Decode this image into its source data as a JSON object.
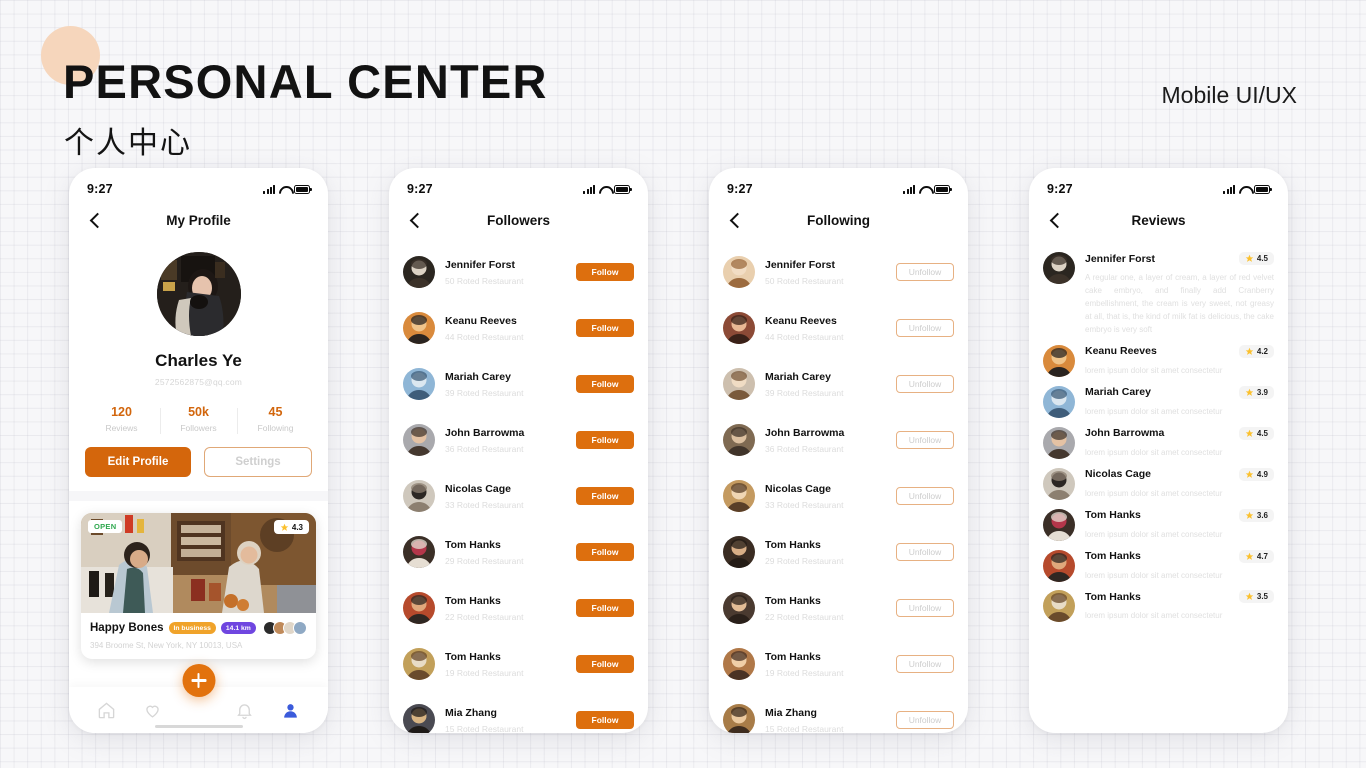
{
  "header": {
    "title": "PERSONAL CENTER",
    "subtitle": "个人中心",
    "tag": "Mobile UI/UX",
    "accent": "#d4660c",
    "circle_color": "#f6d6bc"
  },
  "status_bar": {
    "time": "9:27",
    "icons": [
      "signal-icon",
      "wifi-icon",
      "battery-icon"
    ]
  },
  "screen_profile": {
    "nav_title": "My Profile",
    "back_icon": "chevron-left-icon",
    "name": "Charles Ye",
    "email": "2572562875@qq.com",
    "stats": [
      {
        "value": "120",
        "label": "Reviews"
      },
      {
        "value": "50k",
        "label": "Followers"
      },
      {
        "value": "45",
        "label": "Following"
      }
    ],
    "edit_label": "Edit Profile",
    "settings_label": "Settings",
    "restaurant": {
      "open_badge": "OPEN",
      "rating": "4.3",
      "name": "Happy Bones",
      "chip_business": "In business",
      "chip_distance": "14.1 km",
      "address": "394 Broome St, New York, NY 10013, USA"
    },
    "tabs": [
      "home-icon",
      "heart-icon",
      "add-icon",
      "bell-icon",
      "profile-icon"
    ]
  },
  "screen_followers": {
    "nav_title": "Followers",
    "action_label": "Follow",
    "rows": [
      {
        "name": "Jennifer Forst",
        "sub": "50 Roted Restaurant"
      },
      {
        "name": "Keanu Reeves",
        "sub": "44 Roted Restaurant"
      },
      {
        "name": "Mariah Carey",
        "sub": "39 Roted Restaurant"
      },
      {
        "name": "John Barrowma",
        "sub": "36 Roted Restaurant"
      },
      {
        "name": "Nicolas Cage",
        "sub": "33 Roted Restaurant"
      },
      {
        "name": "Tom Hanks",
        "sub": "29 Roted Restaurant"
      },
      {
        "name": "Tom Hanks",
        "sub": "22 Roted Restaurant"
      },
      {
        "name": "Tom Hanks",
        "sub": "19 Roted Restaurant"
      },
      {
        "name": "Mia Zhang",
        "sub": "15 Roted Restaurant"
      }
    ]
  },
  "screen_following": {
    "nav_title": "Following",
    "action_label": "Unfollow",
    "rows": [
      {
        "name": "Jennifer Forst",
        "sub": "50 Roted Restaurant"
      },
      {
        "name": "Keanu Reeves",
        "sub": "44 Roted Restaurant"
      },
      {
        "name": "Mariah Carey",
        "sub": "39 Roted Restaurant"
      },
      {
        "name": "John Barrowma",
        "sub": "36 Roted Restaurant"
      },
      {
        "name": "Nicolas Cage",
        "sub": "33 Roted Restaurant"
      },
      {
        "name": "Tom Hanks",
        "sub": "29 Roted Restaurant"
      },
      {
        "name": "Tom Hanks",
        "sub": "22 Roted Restaurant"
      },
      {
        "name": "Tom Hanks",
        "sub": "19 Roted Restaurant"
      },
      {
        "name": "Mia Zhang",
        "sub": "15 Roted Restaurant"
      }
    ]
  },
  "screen_reviews": {
    "nav_title": "Reviews",
    "rows": [
      {
        "name": "Jennifer Forst",
        "rating": "4.5",
        "text": "A regular one, a layer of cream, a layer of red velvet cake embryo, and finally add Cranberry embellishment, the cream is very sweet, not greasy at all, that is, the kind of milk fat is delicious, the cake embryo is very soft"
      },
      {
        "name": "Keanu Reeves",
        "rating": "4.2",
        "text": "lorem ipsum dolor sit amet consectetur"
      },
      {
        "name": "Mariah Carey",
        "rating": "3.9",
        "text": "lorem ipsum dolor sit amet consectetur"
      },
      {
        "name": "John Barrowma",
        "rating": "4.5",
        "text": "lorem ipsum dolor sit amet consectetur"
      },
      {
        "name": "Nicolas Cage",
        "rating": "4.9",
        "text": "lorem ipsum dolor sit amet consectetur"
      },
      {
        "name": "Tom Hanks",
        "rating": "3.6",
        "text": "lorem ipsum dolor sit amet consectetur"
      },
      {
        "name": "Tom Hanks",
        "rating": "4.7",
        "text": "lorem ipsum dolor sit amet consectetur"
      },
      {
        "name": "Tom Hanks",
        "rating": "3.5",
        "text": "lorem ipsum dolor sit amet consectetur"
      }
    ]
  }
}
